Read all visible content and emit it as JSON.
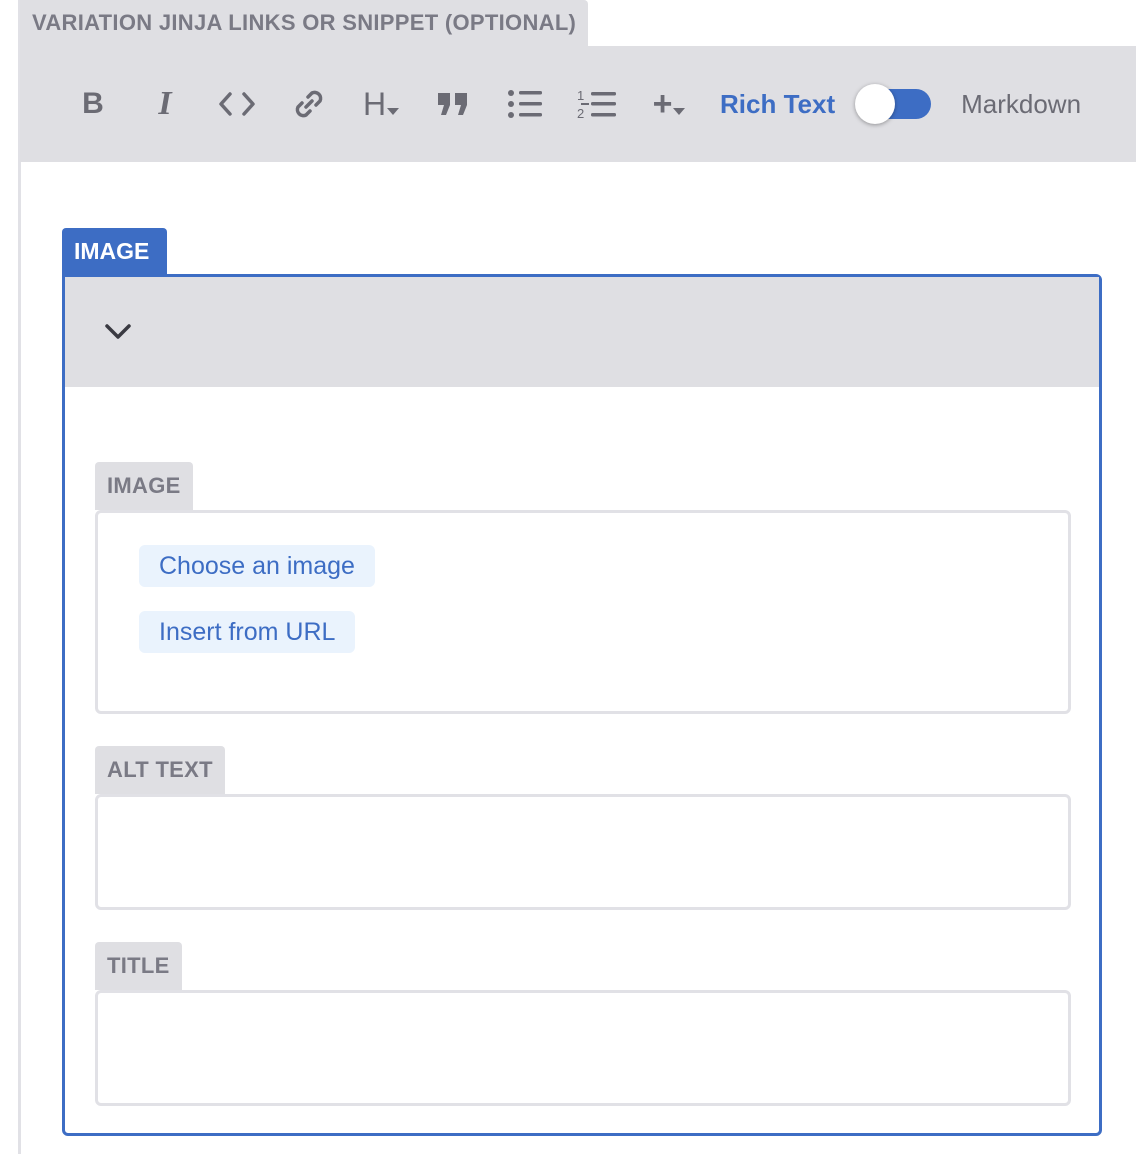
{
  "field": {
    "label": "VARIATION JINJA LINKS OR SNIPPET (OPTIONAL)"
  },
  "toolbar": {
    "buttons": [
      {
        "name": "bold-icon",
        "glyph": "B"
      },
      {
        "name": "italic-icon",
        "glyph": "I"
      },
      {
        "name": "code-icon"
      },
      {
        "name": "link-icon"
      },
      {
        "name": "heading-dropdown-icon",
        "glyph": "H"
      },
      {
        "name": "blockquote-icon"
      },
      {
        "name": "bulleted-list-icon"
      },
      {
        "name": "numbered-list-icon"
      },
      {
        "name": "add-component-dropdown-icon",
        "glyph": "+"
      }
    ],
    "mode_rich": "Rich Text",
    "mode_markdown": "Markdown",
    "toggle_state": "rich-text"
  },
  "block": {
    "tab_label": "IMAGE",
    "collapse_icon": "chevron-down-icon",
    "image_field": {
      "label": "IMAGE",
      "choose_button": "Choose an image",
      "url_button": "Insert from URL"
    },
    "alt_field": {
      "label": "ALT TEXT",
      "value": ""
    },
    "title_field": {
      "label": "TITLE",
      "value": ""
    }
  },
  "colors": {
    "accent": "#3d6dc4",
    "toolbar_bg": "#dfdfe3",
    "label_text": "#7a7a85",
    "pill_bg": "#eaf3fd",
    "border": "#e1e1e6"
  }
}
